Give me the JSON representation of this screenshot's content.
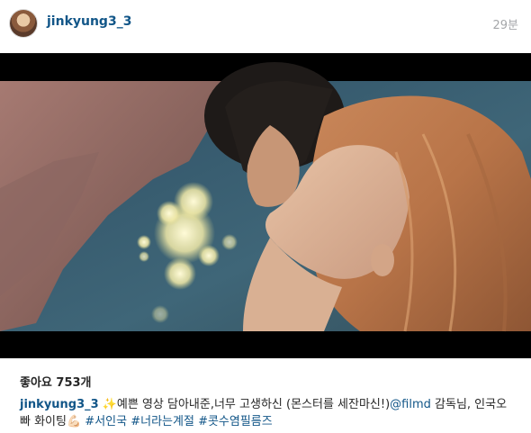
{
  "post": {
    "username": "jinkyung3_3",
    "timestamp": "29분",
    "likes": "좋아요 753개",
    "caption": {
      "username": "jinkyung3_3",
      "text_1": "✨예쁜 영상 담아내준,너무 고생하신 (몬스터를 세잔마신!)",
      "mention": "@filmd",
      "text_2": " 감독님, 인국오빠 화이팅💪🏻 ",
      "hashtags": [
        "#서인국",
        "#너라는계절",
        "#콧수염필름즈"
      ]
    }
  },
  "media": {
    "type": "video-still",
    "letterbox_color": "#000000"
  }
}
